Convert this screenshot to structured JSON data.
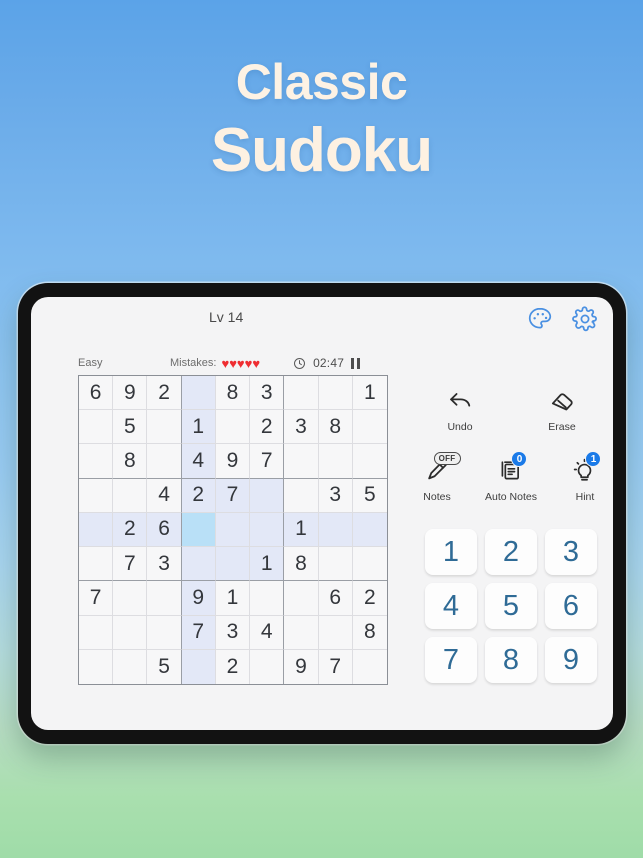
{
  "hero": {
    "line1": "Classic",
    "line2": "Sudoku",
    "title_color": "#fdf2e4"
  },
  "app": {
    "level_label": "Lv 14",
    "top_icons": [
      {
        "name": "palette-icon",
        "label": "Themes"
      },
      {
        "name": "gear-icon",
        "label": "Settings"
      }
    ]
  },
  "status": {
    "difficulty": "Easy",
    "mistakes_label": "Mistakes:",
    "mistakes_hearts": 5,
    "heart_glyph": "♥",
    "heart_color": "#ef2d31",
    "timer": "02:47",
    "pause_label": "Pause"
  },
  "board": {
    "selected_row": 4,
    "selected_col": 3,
    "highlight_color": "#e3e8f7",
    "selected_color": "#b9e0f7",
    "rows": [
      [
        "6",
        "9",
        "2",
        "",
        "8",
        "3",
        "",
        "",
        "1"
      ],
      [
        "",
        "5",
        "",
        "1",
        "",
        "2",
        "3",
        "8",
        ""
      ],
      [
        "",
        "8",
        "",
        "4",
        "9",
        "7",
        "",
        "",
        ""
      ],
      [
        "",
        "",
        "4",
        "2",
        "7",
        "",
        "",
        "3",
        "5"
      ],
      [
        "",
        "2",
        "6",
        "",
        "",
        "",
        "1",
        "",
        ""
      ],
      [
        "",
        "7",
        "3",
        "",
        "",
        "1",
        "8",
        "",
        ""
      ],
      [
        "7",
        "",
        "",
        "9",
        "1",
        "",
        "",
        "6",
        "2"
      ],
      [
        "",
        "",
        "",
        "7",
        "3",
        "4",
        "",
        "",
        "8"
      ],
      [
        "",
        "",
        "5",
        "",
        "2",
        "",
        "9",
        "7",
        ""
      ]
    ]
  },
  "tools": {
    "row1": [
      {
        "name": "undo-button",
        "icon": "undo-icon",
        "label": "Undo"
      },
      {
        "name": "erase-button",
        "icon": "eraser-icon",
        "label": "Erase"
      }
    ],
    "row2": [
      {
        "name": "notes-button",
        "icon": "pencil-icon",
        "label": "Notes",
        "badge": "OFF",
        "badge_type": "pill"
      },
      {
        "name": "auto-notes-button",
        "icon": "notes-pages-icon",
        "label": "Auto Notes",
        "badge": "0",
        "badge_type": "count"
      },
      {
        "name": "hint-button",
        "icon": "lightbulb-icon",
        "label": "Hint",
        "badge": "1",
        "badge_type": "count"
      }
    ]
  },
  "numpad": {
    "keys": [
      "1",
      "2",
      "3",
      "4",
      "5",
      "6",
      "7",
      "8",
      "9"
    ],
    "text_color": "#2f6b96"
  }
}
